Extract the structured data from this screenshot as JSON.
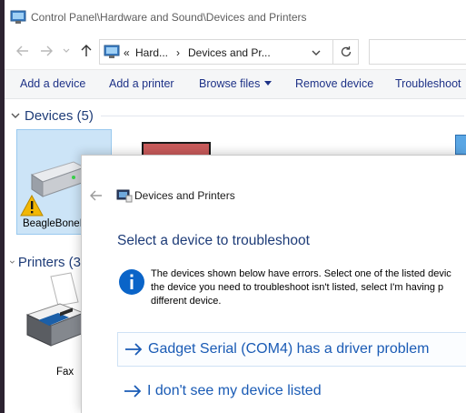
{
  "explorer": {
    "title": "Control Panel\\Hardware and Sound\\Devices and Printers",
    "address": {
      "crumb_overflow": "«",
      "crumb1": "Hard...",
      "separator": "›",
      "crumb2": "Devices and Pr..."
    },
    "commands": {
      "add_device": "Add a device",
      "add_printer": "Add a printer",
      "browse_files": "Browse files",
      "remove_device": "Remove device",
      "troubleshoot": "Troubleshoot"
    },
    "groups": {
      "devices": "Devices (5)",
      "printers": "Printers (3"
    },
    "devices": {
      "beaglebone": "BeagleBoneI"
    },
    "printers": {
      "fax": "Fax"
    }
  },
  "dialog": {
    "title": "Devices and Printers",
    "heading": "Select a device to troubleshoot",
    "info_line1": "The devices shown below have errors. Select one of the listed devic",
    "info_line2": "the device you need to troubleshoot isn't listed, select I'm having p",
    "info_line3": "different device.",
    "choice1": "Gadget Serial (COM4) has a driver problem",
    "choice2": "I don't see my device listed"
  },
  "colors": {
    "link": "#1a5bb5",
    "heading": "#1e3c78",
    "selection": "#cce4f7",
    "info_icon": "#0a64c8"
  }
}
